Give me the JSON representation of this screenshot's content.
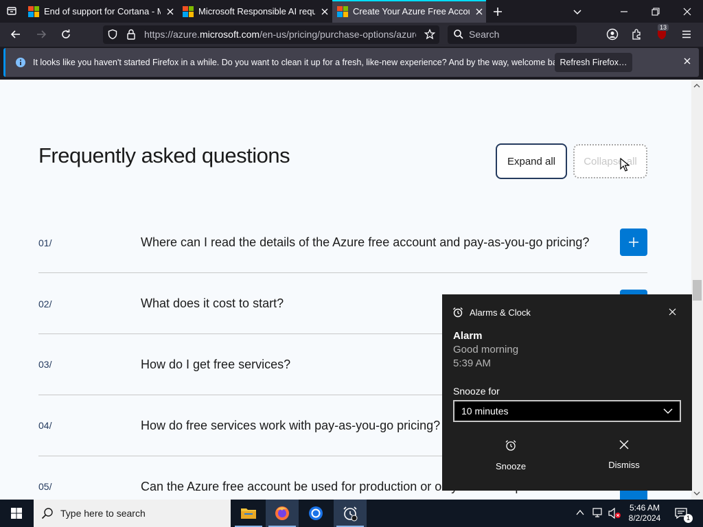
{
  "browser": {
    "tabs": [
      {
        "title": "End of support for Cortana - Mi"
      },
      {
        "title": "Microsoft Responsible AI reque"
      },
      {
        "title": "Create Your Azure Free Account"
      }
    ],
    "url_prefix": "https://azure.",
    "url_domain": "microsoft.com",
    "url_rest": "/en-us/pricing/purchase-options/azure",
    "search_placeholder": "Search",
    "extension_badge": "13",
    "notification": {
      "message": "It looks like you haven't started Firefox in a while. Do you want to clean it up for a fresh, like-new experience? And by the way, welcome back!",
      "button": "Refresh Firefox…"
    }
  },
  "page": {
    "title": "Frequently asked questions",
    "expand_all": "Expand all",
    "collapse_all": "Collapse all",
    "faqs": [
      {
        "num": "01/",
        "question": "Where can I read the details of the Azure free account and pay-as-you-go pricing?"
      },
      {
        "num": "02/",
        "question": "What does it cost to start?"
      },
      {
        "num": "03/",
        "question": "How do I get free services?"
      },
      {
        "num": "04/",
        "question": "How do free services work with pay-as-you-go pricing?"
      },
      {
        "num": "05/",
        "question": "Can the Azure free account be used for production or only for development?"
      }
    ]
  },
  "toast": {
    "app": "Alarms & Clock",
    "title": "Alarm",
    "subtitle": "Good morning",
    "time": "5:39 AM",
    "snooze_label": "Snooze for",
    "snooze_value": "10 minutes",
    "snooze_button": "Snooze",
    "dismiss_button": "Dismiss"
  },
  "taskbar": {
    "search_placeholder": "Type here to search",
    "time": "5:46 AM",
    "date": "8/2/2024",
    "notification_count": "1"
  },
  "colors": {
    "accent_blue": "#0078d4",
    "firefox_tab_highlight": "#00ddff",
    "toast_bg": "#1f1f1f"
  }
}
